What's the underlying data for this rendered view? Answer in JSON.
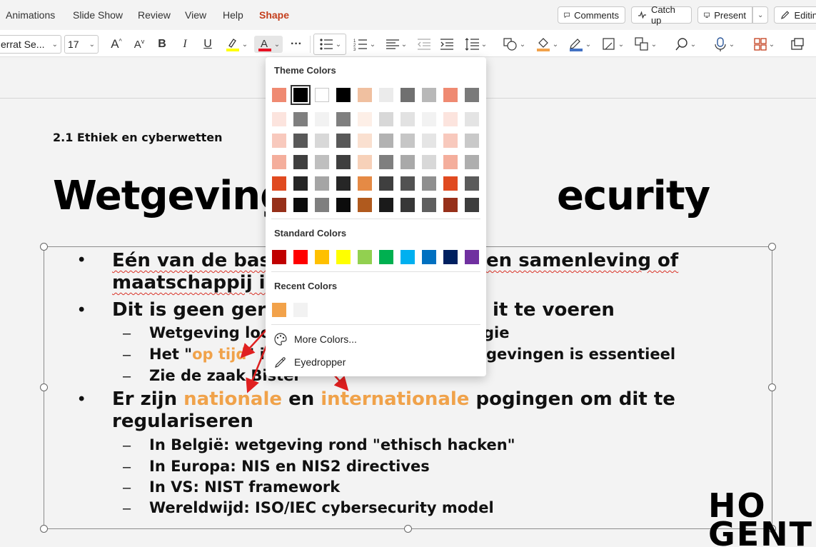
{
  "tabs": [
    "Animations",
    "Slide Show",
    "Review",
    "View",
    "Help",
    "Shape"
  ],
  "active_tab": "Shape",
  "top_buttons": {
    "comments": "Comments",
    "catch_up": "Catch up",
    "present": "Present",
    "editing": "Editin"
  },
  "ribbon": {
    "font_name": "errat Se...",
    "font_size": "17"
  },
  "slide": {
    "breadcrumb": "2.1 Ethiek en cyberwetten",
    "title_left": "Wetgeving",
    "title_right": "ecurity",
    "bullets": [
      {
        "a": "Eén van de bas",
        "b": "en samenleving of"
      },
      {
        "a": "maatschappij i"
      },
      {
        "a": "Dit is geen ger",
        "b": "it te voeren"
      }
    ],
    "sub1": {
      "a": "Wetgeving loo",
      "b": "gie"
    },
    "sub2": {
      "a": "Het \"",
      "orange": "op tijd",
      "b": "\" in",
      "c": "gevingen is essentieel"
    },
    "sub3": "Zie de zaak Bister",
    "bullet3": {
      "a": "Er zijn ",
      "orange1": "nationale",
      "b": " en ",
      "orange2": "internationale",
      "c": " pogingen om dit te"
    },
    "bullet3_cont": "regulariseren",
    "subs": [
      "In België: wetgeving rond \"ethisch hacken\"",
      "In Europa: NIS en NIS2 directives",
      "In VS: NIST framework",
      "Wereldwijd: ISO/IEC cybersecurity model"
    ],
    "logo_line1": "HO",
    "logo_line2": "GENT"
  },
  "dropdown": {
    "theme_label": "Theme Colors",
    "standard_label": "Standard Colors",
    "recent_label": "Recent Colors",
    "more_colors": "More Colors...",
    "eyedropper": "Eyedropper",
    "theme_top": [
      "#ef8a72",
      "#000000",
      "#ffffff",
      "#000000",
      "#f0c0a0",
      "#ebebeb",
      "#707070",
      "#b8b8b8",
      "#ef8a72",
      "#7a7a7a"
    ],
    "theme_shades": [
      [
        "#fce4de",
        "#7f7f7f",
        "#f2f2f2",
        "#7f7f7f",
        "#fdefe7",
        "#d8d8d8",
        "#e2e2e2",
        "#f2f2f2",
        "#fce4de",
        "#e4e4e4"
      ],
      [
        "#f8c9bd",
        "#595959",
        "#d8d8d8",
        "#595959",
        "#fae0d0",
        "#b2b2b2",
        "#c6c6c6",
        "#e5e5e5",
        "#f8c9bd",
        "#c9c9c9"
      ],
      [
        "#f4ae9c",
        "#3f3f3f",
        "#bfbfbf",
        "#3f3f3f",
        "#f7d1b9",
        "#7f7f7f",
        "#a9a9a9",
        "#d8d8d8",
        "#f4ae9c",
        "#aeaeae"
      ],
      [
        "#e04a20",
        "#262626",
        "#a5a5a5",
        "#262626",
        "#e58a45",
        "#3f3f3f",
        "#525252",
        "#8f8f8f",
        "#e04a20",
        "#5b5b5b"
      ],
      [
        "#96301a",
        "#0c0c0c",
        "#7f7f7f",
        "#0c0c0c",
        "#b05a1e",
        "#1a1a1a",
        "#373737",
        "#5f5f5f",
        "#96301a",
        "#3d3d3d"
      ]
    ],
    "standard": [
      "#c00000",
      "#ff0000",
      "#ffc000",
      "#ffff00",
      "#92d050",
      "#00b050",
      "#00b0f0",
      "#0070c0",
      "#002060",
      "#7030a0"
    ],
    "recent": [
      "#f2a24a",
      "#f2f2f2"
    ]
  }
}
